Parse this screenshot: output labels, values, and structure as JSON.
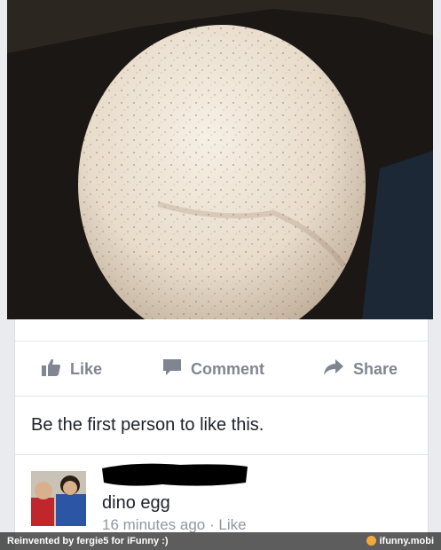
{
  "post": {
    "photo_alt": "photo",
    "actions": {
      "like_label": "Like",
      "comment_label": "Comment",
      "share_label": "Share"
    },
    "likes_summary": "Be the first person to like this."
  },
  "comment": {
    "text": "dino egg",
    "time": "16 minutes ago",
    "separator": " · ",
    "like_label": "Like"
  },
  "watermark": {
    "credit": "Reinvented by fergie5 for iFunny :)",
    "brand": "ifunny.mobi"
  },
  "colors": {
    "background": "#e9ebee",
    "action_text": "#7f8691",
    "meta_text": "#9197a3",
    "body_text": "#1d2129",
    "brand_accent": "#f2a93b"
  },
  "icons": [
    "thumbs-up-icon",
    "comment-bubble-icon",
    "share-arrow-icon",
    "ifunny-logo-icon"
  ]
}
